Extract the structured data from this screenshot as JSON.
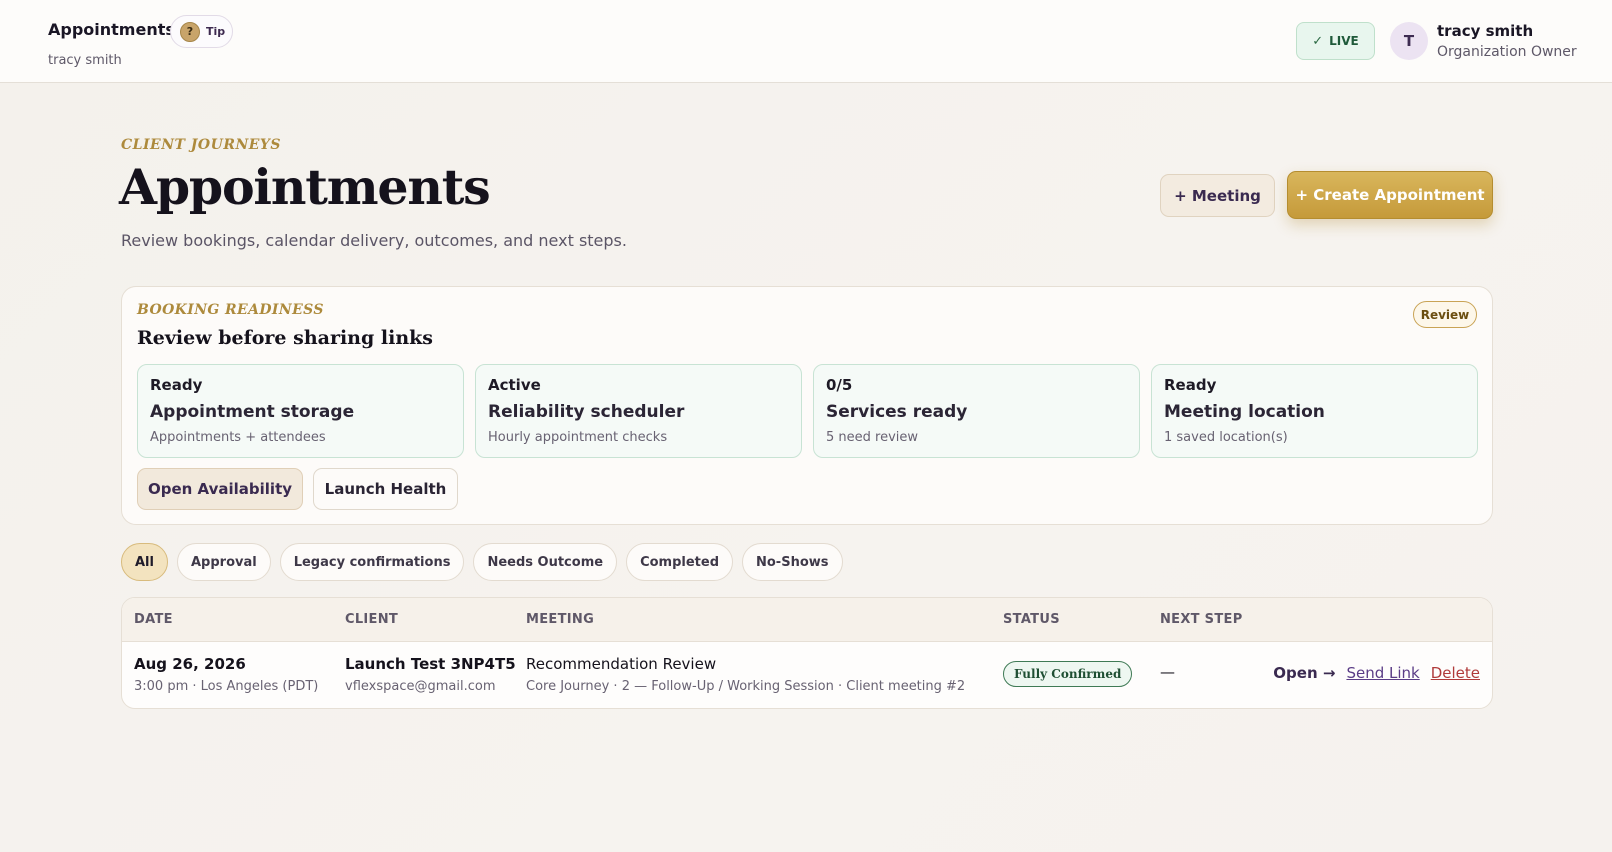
{
  "topbar": {
    "title": "Appointments",
    "tip": {
      "icon": "?",
      "label": "Tip"
    },
    "subtitle": "tracy smith",
    "live": {
      "icon": "✓",
      "label": "LIVE"
    },
    "user": {
      "initial": "T",
      "name": "tracy smith",
      "role": "Organization Owner"
    }
  },
  "header": {
    "eyebrow": "CLIENT JOURNEYS",
    "title": "Appointments",
    "subtitle": "Review bookings, calendar delivery, outcomes, and next steps.",
    "meeting_button": "+ Meeting",
    "create_button": "+ Create Appointment"
  },
  "readiness": {
    "eyebrow": "BOOKING READINESS",
    "title": "Review before sharing links",
    "badge": "Review",
    "tiles": [
      {
        "state": "Ready",
        "name": "Appointment storage",
        "desc": "Appointments + attendees"
      },
      {
        "state": "Active",
        "name": "Reliability scheduler",
        "desc": "Hourly appointment checks"
      },
      {
        "state": "0/5",
        "name": "Services ready",
        "desc": "5 need review"
      },
      {
        "state": "Ready",
        "name": "Meeting location",
        "desc": "1 saved location(s)"
      }
    ],
    "actions": {
      "open_availability": "Open Availability",
      "launch_health": "Launch Health"
    }
  },
  "filters": [
    "All",
    "Approval",
    "Legacy confirmations",
    "Needs Outcome",
    "Completed",
    "No-Shows"
  ],
  "active_filter": "All",
  "table": {
    "headers": {
      "date": "DATE",
      "client": "CLIENT",
      "meeting": "MEETING",
      "status": "STATUS",
      "next_step": "NEXT STEP"
    },
    "rows": [
      {
        "date": "Aug 26, 2026",
        "time": "3:00 pm · Los Angeles (PDT)",
        "client": "Launch Test 3NP4T5",
        "email": "vflexspace@gmail.com",
        "meeting": "Recommendation Review",
        "meeting_detail": "Core Journey · 2 — Follow-Up / Working Session · Client meeting #2",
        "status": "Fully Confirmed",
        "next_step": "—",
        "actions": {
          "open": "Open →",
          "send_link": "Send Link",
          "delete": "Delete"
        }
      }
    ]
  },
  "colors": {
    "accent_gold": "#c59a3a",
    "live_green": "#1f5a3a",
    "status_green": "#3f7a55",
    "delete_red": "#b03a3a"
  }
}
